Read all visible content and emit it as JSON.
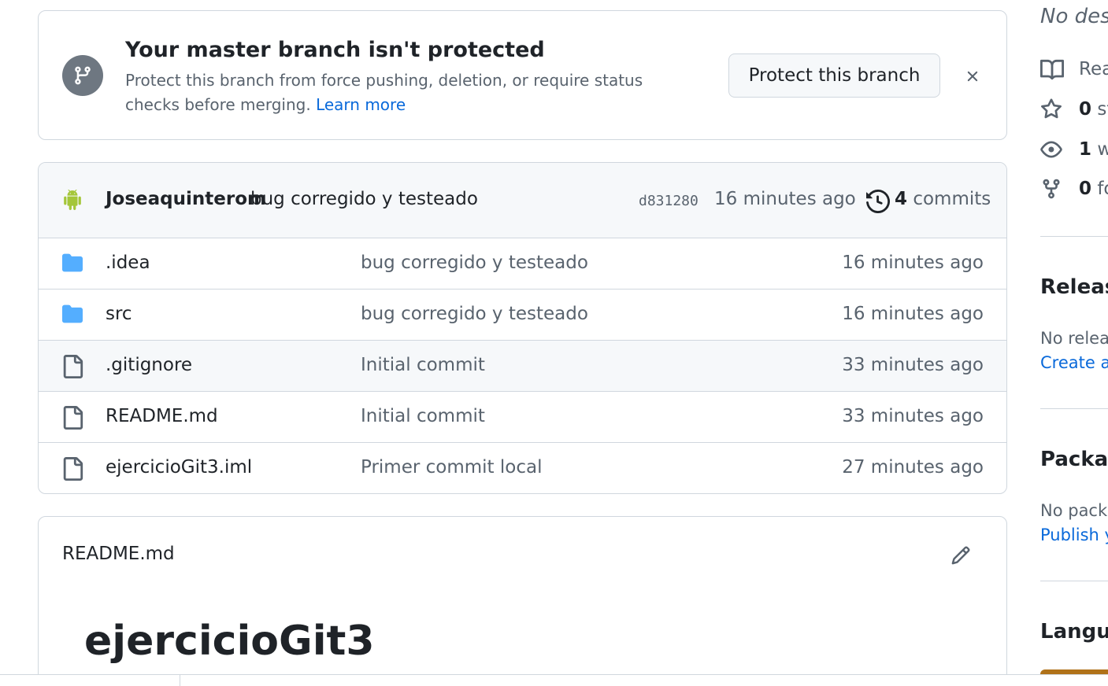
{
  "banner": {
    "title": "Your master branch isn't protected",
    "description": "Protect this branch from force pushing, deletion, or require status checks before merging.",
    "learn_more": "Learn more",
    "protect_button": "Protect this branch"
  },
  "latest_commit": {
    "author": "Joseaquinterom",
    "message": "bug corregido y testeado",
    "sha": "d831280",
    "time": "16 minutes ago",
    "commit_count": "4",
    "commits_label": "commits"
  },
  "files": [
    {
      "type": "folder",
      "name": ".idea",
      "message": "bug corregido y testeado",
      "time": "16 minutes ago"
    },
    {
      "type": "folder",
      "name": "src",
      "message": "bug corregido y testeado",
      "time": "16 minutes ago"
    },
    {
      "type": "file",
      "name": ".gitignore",
      "message": "Initial commit",
      "time": "33 minutes ago"
    },
    {
      "type": "file",
      "name": "README.md",
      "message": "Initial commit",
      "time": "33 minutes ago"
    },
    {
      "type": "file",
      "name": "ejercicioGit3.iml",
      "message": "Primer commit local",
      "time": "27 minutes ago"
    }
  ],
  "readme": {
    "title": "README.md",
    "heading": "ejercicioGit3"
  },
  "sidebar": {
    "description": "No desc",
    "readme": "Rea",
    "stars_count": "0",
    "stars_label": "st",
    "watchers_count": "1",
    "watchers_label": "wa",
    "forks_count": "0",
    "forks_label": "fo",
    "releases_heading": "Release",
    "releases_text": "No releas",
    "releases_link": "Create a r",
    "packages_heading": "Packag",
    "packages_text": "No packa",
    "packages_link": "Publish yo",
    "languages_heading": "Langua"
  },
  "colors": {
    "accent": "#0969da",
    "android": "#a4c639",
    "folder": "#54aeff",
    "java": "#b07219"
  }
}
